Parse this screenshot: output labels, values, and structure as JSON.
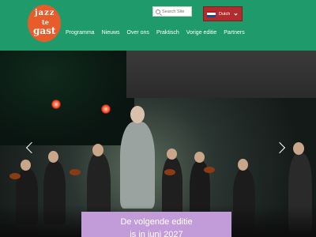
{
  "logo": {
    "lines": [
      "jazz",
      "te",
      "gast"
    ],
    "accent": "#e85c2c"
  },
  "header": {
    "background": "#1f9a6a"
  },
  "nav": {
    "items": [
      {
        "label": "Programma"
      },
      {
        "label": "Nieuws"
      },
      {
        "label": "Over ons"
      },
      {
        "label": "Praktisch"
      },
      {
        "label": "Vorige editie"
      },
      {
        "label": "Partners"
      }
    ]
  },
  "search": {
    "placeholder": "Search Site",
    "icon": "search-icon"
  },
  "language": {
    "selected": "Dutch",
    "icon": "netherlands-flag-icon",
    "background": "#b12d2d"
  },
  "carousel": {
    "prev_icon": "chevron-left-icon",
    "next_icon": "chevron-right-icon"
  },
  "banner": {
    "line1": "De volgende editie",
    "line2": "is in juni 2027",
    "background": "#c29bd9"
  }
}
